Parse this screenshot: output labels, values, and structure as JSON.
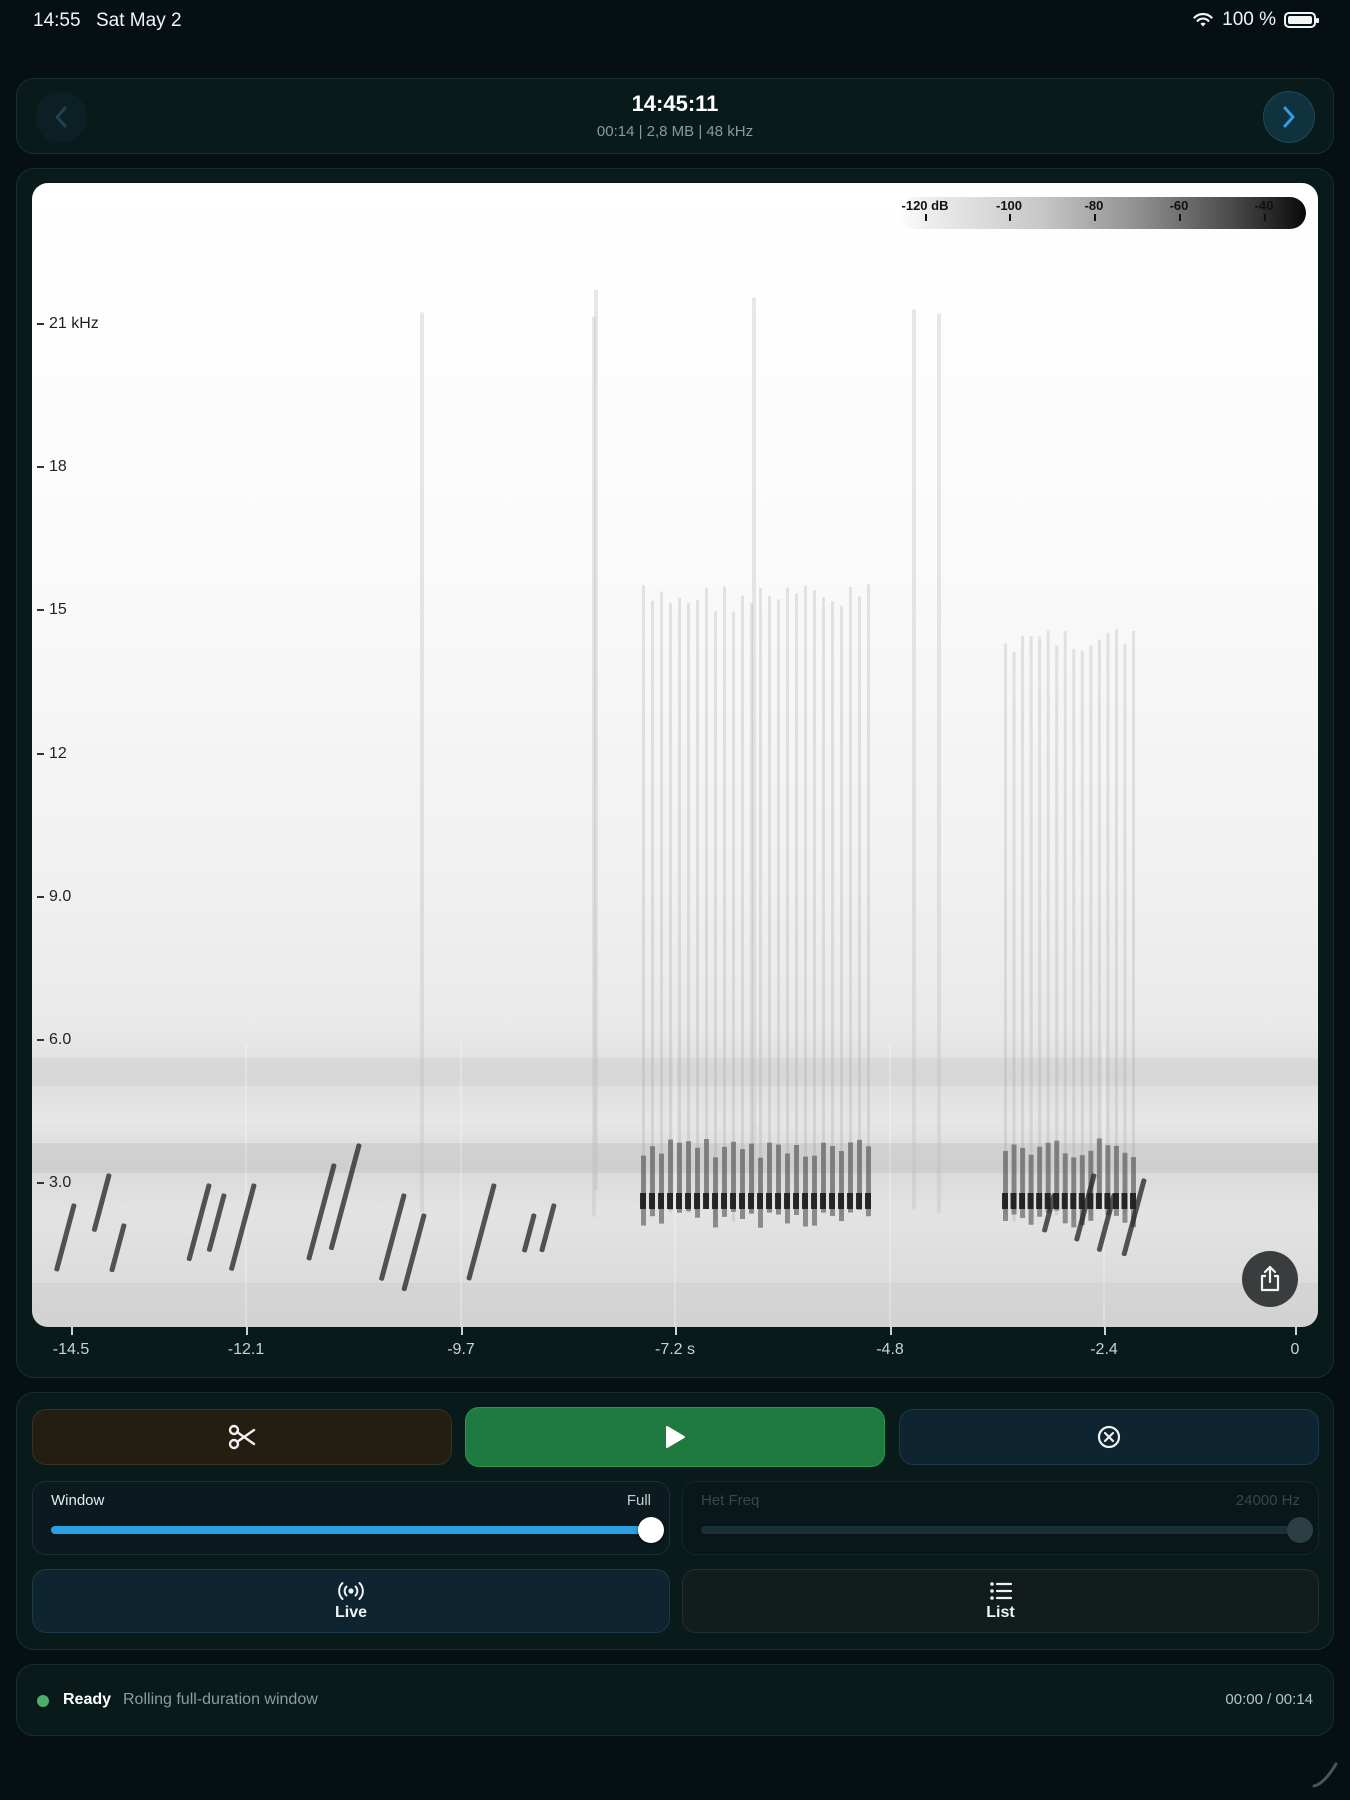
{
  "status_bar": {
    "time": "14:55",
    "date": "Sat May 2",
    "battery_text": "100 %",
    "wifi_icon": "wifi-icon",
    "battery_icon": "battery-icon"
  },
  "recording": {
    "title": "14:45:11",
    "meta": "00:14 | 2,8 MB | 48 kHz"
  },
  "spectrogram": {
    "colorbar_labels": [
      "-120 dB",
      "-100",
      "-80",
      "-60",
      "-40"
    ],
    "y_axis_labels": [
      "21 kHz",
      "18",
      "15",
      "12",
      "9.0",
      "6.0",
      "3.0"
    ],
    "x_axis_labels": [
      "-14.5",
      "-12.1",
      "-9.7",
      "-7.2 s",
      "-4.8",
      "-2.4",
      "0"
    ],
    "share_icon": "share-icon"
  },
  "controls": {
    "trim_icon": "scissors-icon",
    "play_icon": "play-icon",
    "clear_icon": "circle-x-icon",
    "window_slider": {
      "label": "Window",
      "value": "Full",
      "fraction": 1.0
    },
    "het_slider": {
      "label": "Het Freq",
      "value": "24000 Hz",
      "fraction": 1.0,
      "disabled": true
    },
    "tabs": [
      {
        "label": "Live",
        "icon": "broadcast-icon"
      },
      {
        "label": "List",
        "icon": "list-icon"
      }
    ]
  },
  "status": {
    "state": "Ready",
    "message": "Rolling full-duration window",
    "playback_time": "00:00 / 00:14"
  },
  "colors": {
    "accent_blue": "#2f9fe3",
    "play_green": "#1e7a3e",
    "ready_green": "#4caf6e",
    "background": "#061014"
  }
}
